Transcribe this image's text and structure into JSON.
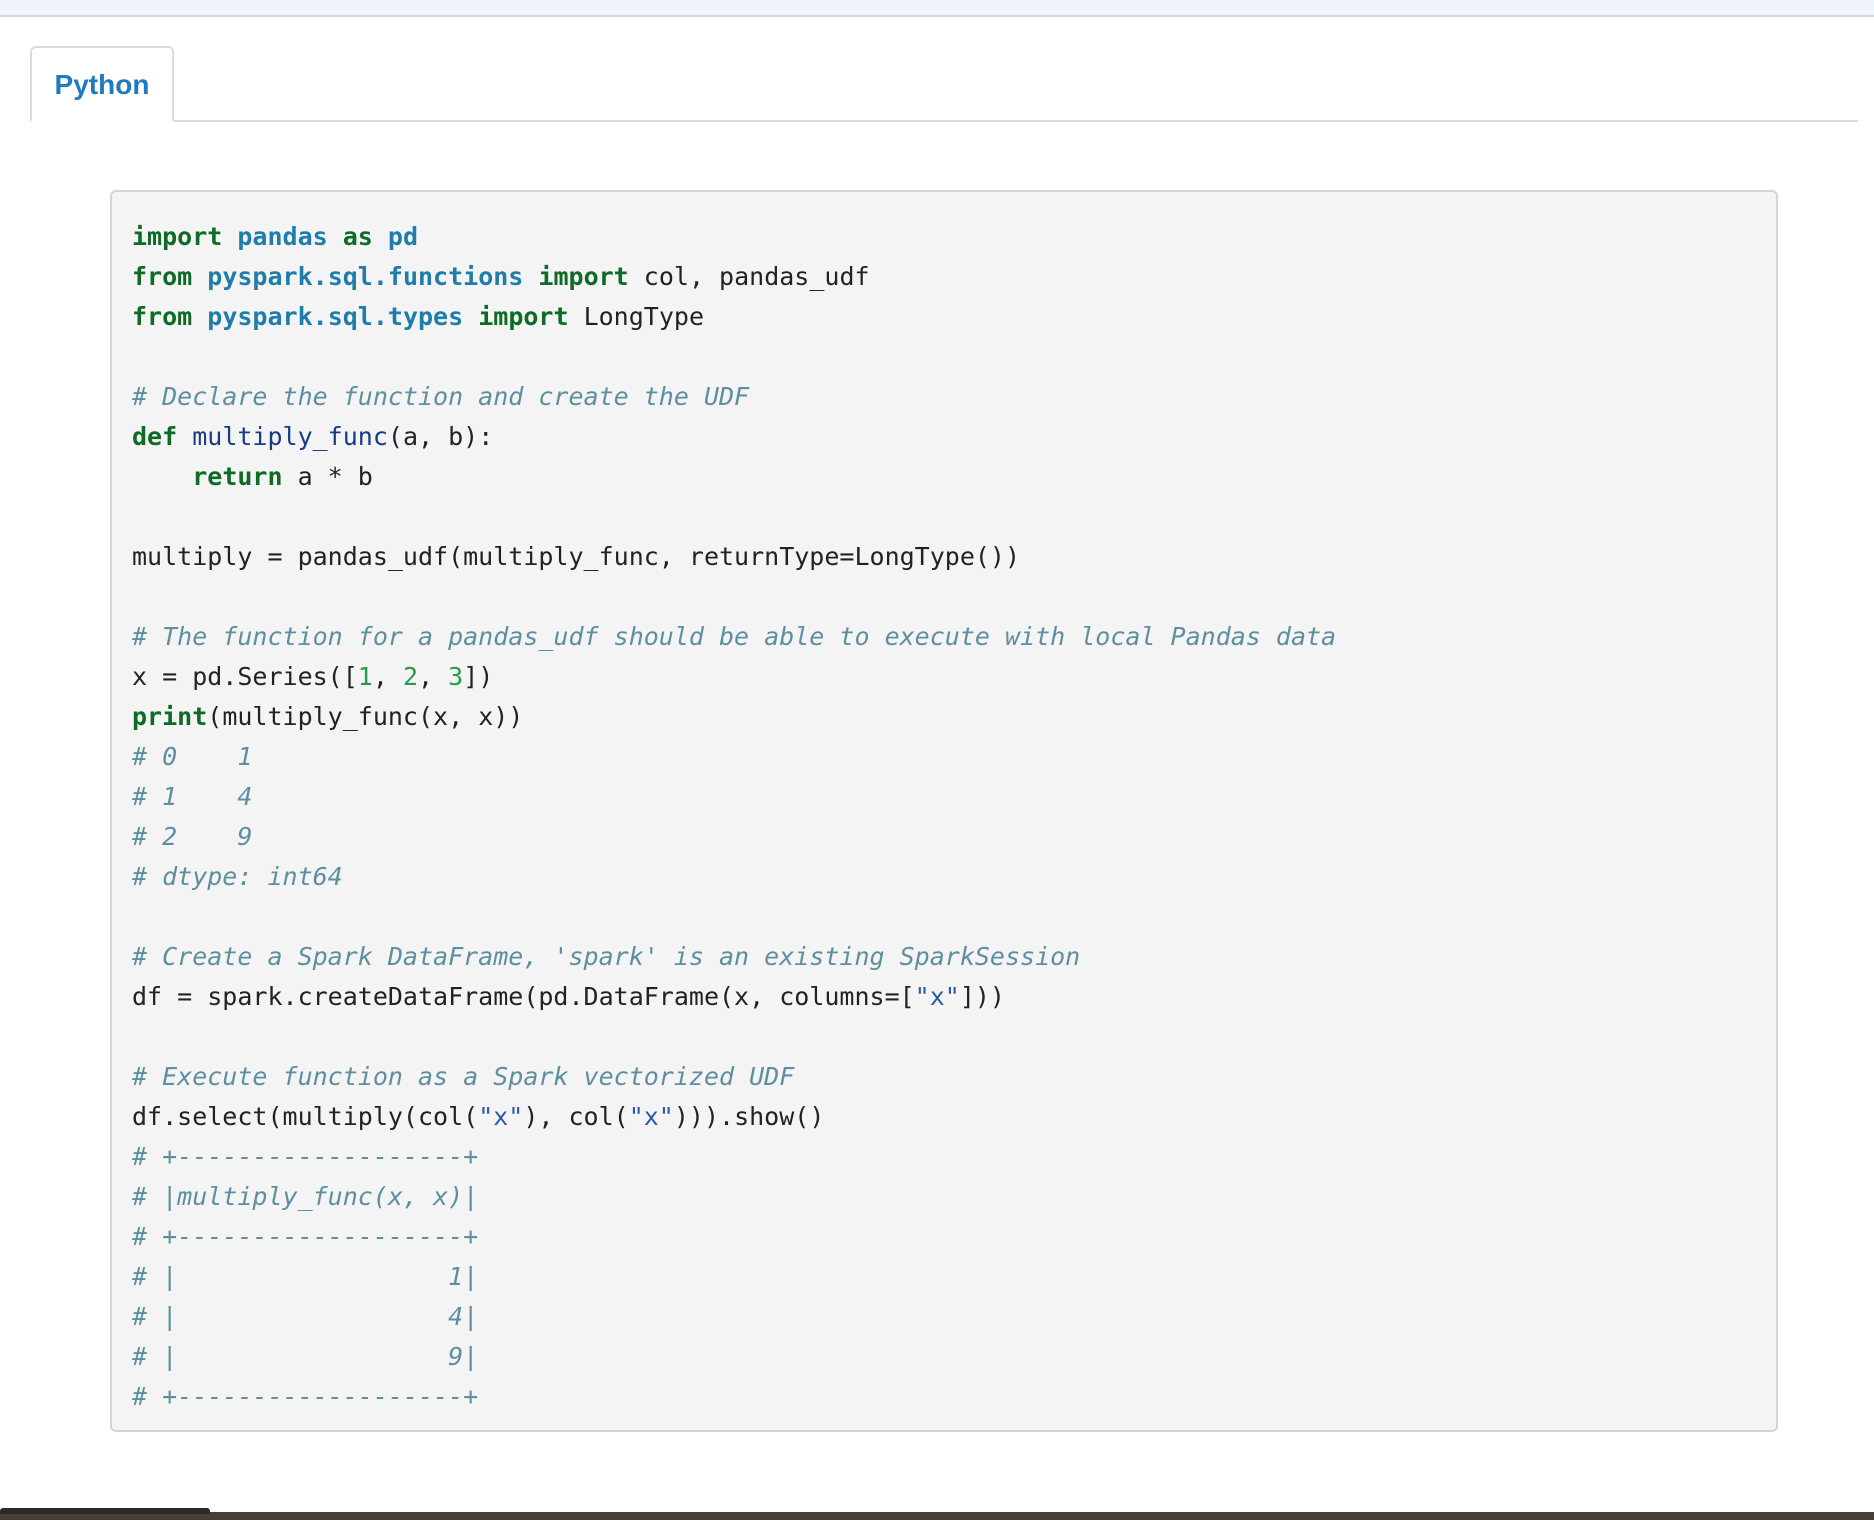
{
  "tabs": {
    "python": "Python"
  },
  "code": {
    "language": "python",
    "lines": [
      [
        {
          "t": "import",
          "c": "kw"
        },
        {
          "t": " ",
          "c": ""
        },
        {
          "t": "pandas",
          "c": "nm"
        },
        {
          "t": " ",
          "c": ""
        },
        {
          "t": "as",
          "c": "kw"
        },
        {
          "t": " ",
          "c": ""
        },
        {
          "t": "pd",
          "c": "nm"
        }
      ],
      [
        {
          "t": "from",
          "c": "kw"
        },
        {
          "t": " ",
          "c": ""
        },
        {
          "t": "pyspark.sql.functions",
          "c": "nm"
        },
        {
          "t": " ",
          "c": ""
        },
        {
          "t": "import",
          "c": "kw"
        },
        {
          "t": " col, pandas_udf",
          "c": ""
        }
      ],
      [
        {
          "t": "from",
          "c": "kw"
        },
        {
          "t": " ",
          "c": ""
        },
        {
          "t": "pyspark.sql.types",
          "c": "nm"
        },
        {
          "t": " ",
          "c": ""
        },
        {
          "t": "import",
          "c": "kw"
        },
        {
          "t": " LongType",
          "c": ""
        }
      ],
      [],
      [
        {
          "t": "# Declare the function and create the UDF",
          "c": "cm"
        }
      ],
      [
        {
          "t": "def",
          "c": "kw"
        },
        {
          "t": " ",
          "c": ""
        },
        {
          "t": "multiply_func",
          "c": "fn"
        },
        {
          "t": "(a, b):",
          "c": ""
        }
      ],
      [
        {
          "t": "    ",
          "c": ""
        },
        {
          "t": "return",
          "c": "kw"
        },
        {
          "t": " a * b",
          "c": ""
        }
      ],
      [],
      [
        {
          "t": "multiply = pandas_udf(multiply_func, returnType=LongType())",
          "c": ""
        }
      ],
      [],
      [
        {
          "t": "# The function for a pandas_udf should be able to execute with local Pandas data",
          "c": "cm"
        }
      ],
      [
        {
          "t": "x = pd.Series([",
          "c": ""
        },
        {
          "t": "1",
          "c": "num"
        },
        {
          "t": ", ",
          "c": ""
        },
        {
          "t": "2",
          "c": "num"
        },
        {
          "t": ", ",
          "c": ""
        },
        {
          "t": "3",
          "c": "num"
        },
        {
          "t": "])",
          "c": ""
        }
      ],
      [
        {
          "t": "print",
          "c": "kw"
        },
        {
          "t": "(multiply_func(x, x))",
          "c": ""
        }
      ],
      [
        {
          "t": "# 0    1",
          "c": "cm"
        }
      ],
      [
        {
          "t": "# 1    4",
          "c": "cm"
        }
      ],
      [
        {
          "t": "# 2    9",
          "c": "cm"
        }
      ],
      [
        {
          "t": "# dtype: int64",
          "c": "cm"
        }
      ],
      [],
      [
        {
          "t": "# Create a Spark DataFrame, 'spark' is an existing SparkSession",
          "c": "cm"
        }
      ],
      [
        {
          "t": "df = spark.createDataFrame(pd.DataFrame(x, columns=[",
          "c": ""
        },
        {
          "t": "\"x\"",
          "c": "str"
        },
        {
          "t": "]))",
          "c": ""
        }
      ],
      [],
      [
        {
          "t": "# Execute function as a Spark vectorized UDF",
          "c": "cm"
        }
      ],
      [
        {
          "t": "df.select(multiply(col(",
          "c": ""
        },
        {
          "t": "\"x\"",
          "c": "str"
        },
        {
          "t": "), col(",
          "c": ""
        },
        {
          "t": "\"x\"",
          "c": "str"
        },
        {
          "t": "))).show()",
          "c": ""
        }
      ],
      [
        {
          "t": "# +-------------------+",
          "c": "cm"
        }
      ],
      [
        {
          "t": "# |multiply_func(x, x)|",
          "c": "cm"
        }
      ],
      [
        {
          "t": "# +-------------------+",
          "c": "cm"
        }
      ],
      [
        {
          "t": "# |                  1|",
          "c": "cm"
        }
      ],
      [
        {
          "t": "# |                  4|",
          "c": "cm"
        }
      ],
      [
        {
          "t": "# |                  9|",
          "c": "cm"
        }
      ],
      [
        {
          "t": "# +-------------------+",
          "c": "cm"
        }
      ]
    ]
  },
  "colors": {
    "tab_active": "#1f7bc0",
    "keyword": "#0e6b26",
    "module_name": "#1e7dab",
    "function_name": "#173c80",
    "comment": "#5e8fa0",
    "number": "#2a9a4c",
    "string": "#2a5aa8",
    "code_background": "#f4f4f4"
  }
}
